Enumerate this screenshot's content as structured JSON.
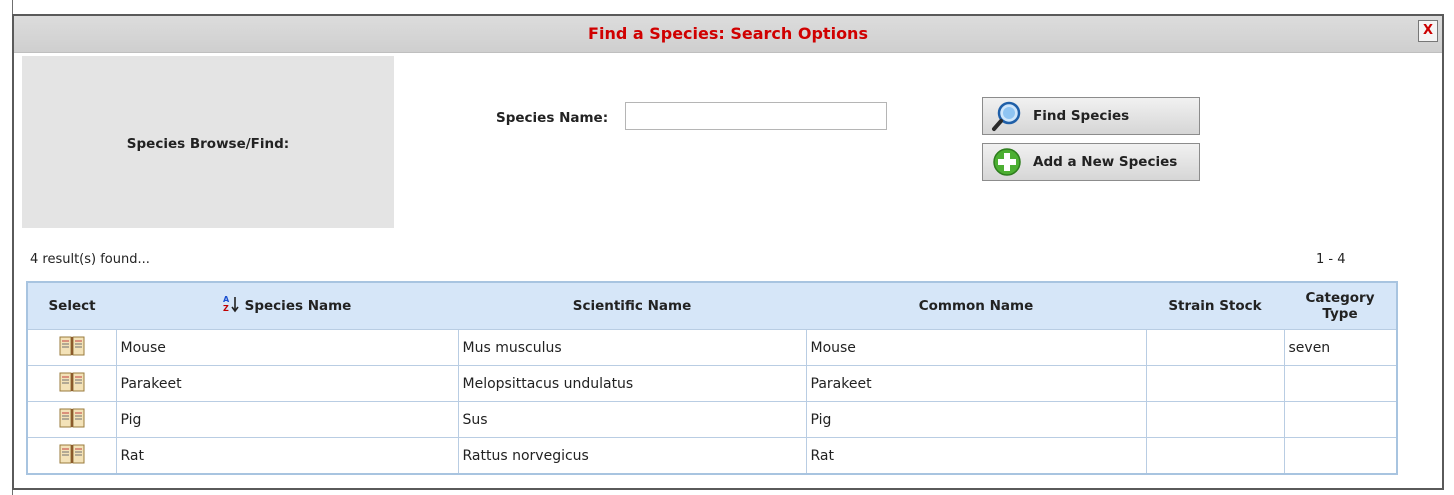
{
  "dialog": {
    "title": "Find a Species: Search Options",
    "close_label": "X"
  },
  "browse_panel": {
    "label": "Species Browse/Find:"
  },
  "search": {
    "field_label": "Species Name:",
    "value": "",
    "placeholder": ""
  },
  "buttons": {
    "find_label": "Find Species",
    "add_label": "Add a New Species"
  },
  "results": {
    "count_text": "4 result(s) found...",
    "paging_text": "1 - 4"
  },
  "table": {
    "columns": [
      "Select",
      "Species Name",
      "Scientific Name",
      "Common Name",
      "Strain Stock",
      "Category Type"
    ],
    "rows": [
      {
        "species_name": "Mouse",
        "scientific_name": "Mus musculus",
        "common_name": "Mouse",
        "strain_stock": "",
        "category_type": "seven"
      },
      {
        "species_name": "Parakeet",
        "scientific_name": "Melopsittacus undulatus",
        "common_name": "Parakeet",
        "strain_stock": "",
        "category_type": ""
      },
      {
        "species_name": "Pig",
        "scientific_name": "Sus",
        "common_name": "Pig",
        "strain_stock": "",
        "category_type": ""
      },
      {
        "species_name": "Rat",
        "scientific_name": "Rattus norvegicus",
        "common_name": "Rat",
        "strain_stock": "",
        "category_type": ""
      }
    ]
  },
  "icons": {
    "find": "magnifier-icon",
    "add": "plus-circle-icon",
    "select": "book-icon",
    "sort": "sort-az-icon",
    "close": "close-icon"
  },
  "colors": {
    "title": "#d00000",
    "header_bg": "#d6e6f8",
    "table_border": "#a8c4e0",
    "panel_bg": "#e4e4e4",
    "add_icon": "#4caf32",
    "find_icon": "#2f7fd4"
  }
}
